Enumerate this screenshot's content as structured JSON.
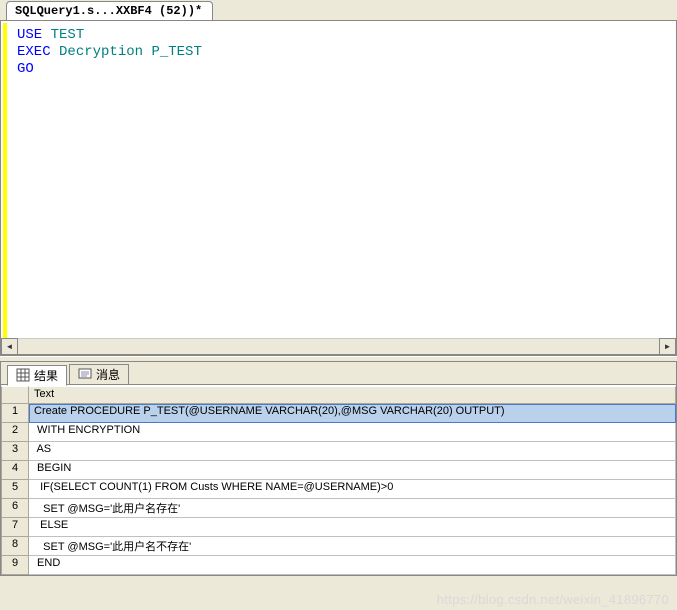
{
  "tab": {
    "title": "SQLQuery1.s...XXBF4 (52))*"
  },
  "editor": {
    "lines": [
      {
        "tokens": [
          {
            "t": "kw",
            "v": "USE"
          },
          {
            "t": "plain",
            "v": " "
          },
          {
            "t": "ident",
            "v": "TEST"
          }
        ]
      },
      {
        "tokens": [
          {
            "t": "kw",
            "v": "EXEC"
          },
          {
            "t": "plain",
            "v": " "
          },
          {
            "t": "ident",
            "v": "Decryption"
          },
          {
            "t": "plain",
            "v": " "
          },
          {
            "t": "ident",
            "v": "P_TEST"
          }
        ]
      },
      {
        "tokens": [
          {
            "t": "kw",
            "v": "GO"
          }
        ]
      }
    ]
  },
  "results": {
    "tabs": {
      "results_label": "结果",
      "messages_label": "消息"
    },
    "column_header": "Text",
    "rows": [
      {
        "n": "1",
        "text": "Create PROCEDURE P_TEST(@USERNAME VARCHAR(20),@MSG VARCHAR(20) OUTPUT)"
      },
      {
        "n": "2",
        "text": " WITH ENCRYPTION"
      },
      {
        "n": "3",
        "text": " AS"
      },
      {
        "n": "4",
        "text": " BEGIN"
      },
      {
        "n": "5",
        "text": "  IF(SELECT COUNT(1) FROM Custs WHERE NAME=@USERNAME)>0"
      },
      {
        "n": "6",
        "text": "   SET @MSG='此用户名存在'"
      },
      {
        "n": "7",
        "text": "  ELSE"
      },
      {
        "n": "8",
        "text": "   SET @MSG='此用户名不存在'"
      },
      {
        "n": "9",
        "text": " END"
      }
    ]
  },
  "watermark": "https://blog.csdn.net/weixin_41896770"
}
